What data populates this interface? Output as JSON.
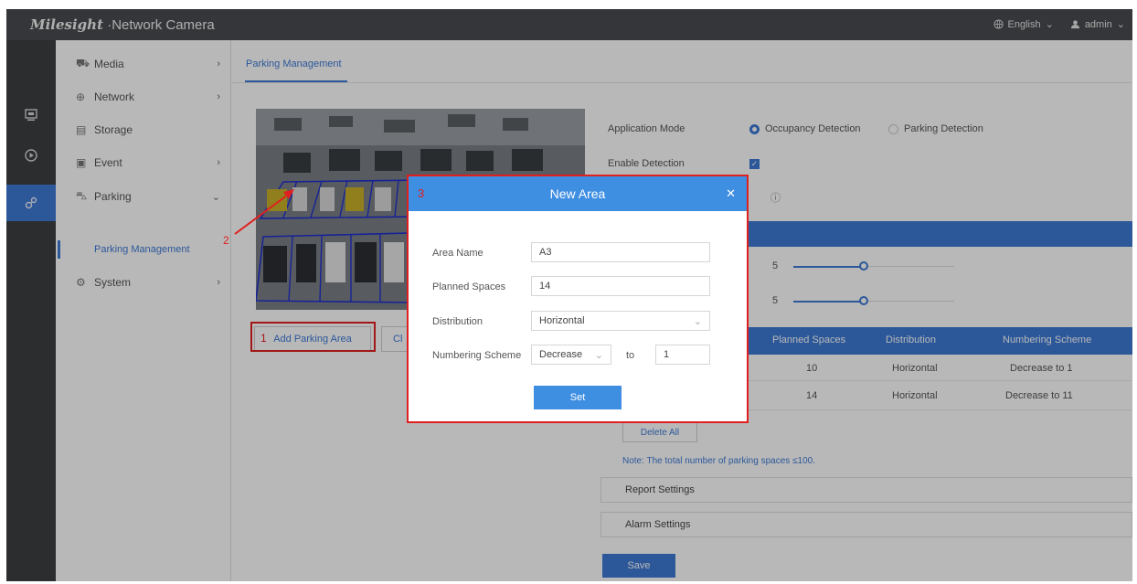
{
  "topbar": {
    "brand_script": "Milesight",
    "brand_rest": "Network Camera",
    "language": "English",
    "user": "admin"
  },
  "sidebar": {
    "items": [
      {
        "label": "Media",
        "icon": "media-icon"
      },
      {
        "label": "Network",
        "icon": "globe-icon"
      },
      {
        "label": "Storage",
        "icon": "storage-icon"
      },
      {
        "label": "Event",
        "icon": "event-icon"
      },
      {
        "label": "Parking",
        "icon": "car-icon"
      },
      {
        "label": "System",
        "icon": "system-icon"
      }
    ],
    "sub_item": "Parking Management"
  },
  "main": {
    "tab": "Parking Management",
    "add_area_button": "Add Parking Area",
    "clear_button": "Cl",
    "application_mode_label": "Application Mode",
    "mode_options": [
      "Occupancy Detection",
      "Parking Detection"
    ],
    "enable_detection_label": "Enable Detection",
    "slider_values": [
      "5",
      "5"
    ],
    "table": {
      "headers": [
        "Planned Spaces",
        "Distribution",
        "Numbering Scheme"
      ],
      "rows": [
        [
          "10",
          "Horizontal",
          "Decrease to 1"
        ],
        [
          "14",
          "Horizontal",
          "Decrease to 11"
        ]
      ]
    },
    "delete_all_button": "Delete All",
    "note": "Note: The total number of parking spaces ≤100.",
    "report_settings": "Report Settings",
    "alarm_settings": "Alarm Settings",
    "save_button": "Save"
  },
  "modal": {
    "title": "New Area",
    "area_name_label": "Area Name",
    "area_name_value": "A3",
    "planned_spaces_label": "Planned Spaces",
    "planned_spaces_value": "14",
    "distribution_label": "Distribution",
    "distribution_value": "Horizontal",
    "numbering_scheme_label": "Numbering Scheme",
    "numbering_scheme_value": "Decrease",
    "to_label": "to",
    "to_value": "1",
    "set_button": "Set"
  },
  "annotations": {
    "step1": "1",
    "step2": "2",
    "step3": "3"
  },
  "colors": {
    "accent": "#3e7ad6",
    "annotation_red": "#e02020",
    "topbar": "#4a4c4f"
  }
}
